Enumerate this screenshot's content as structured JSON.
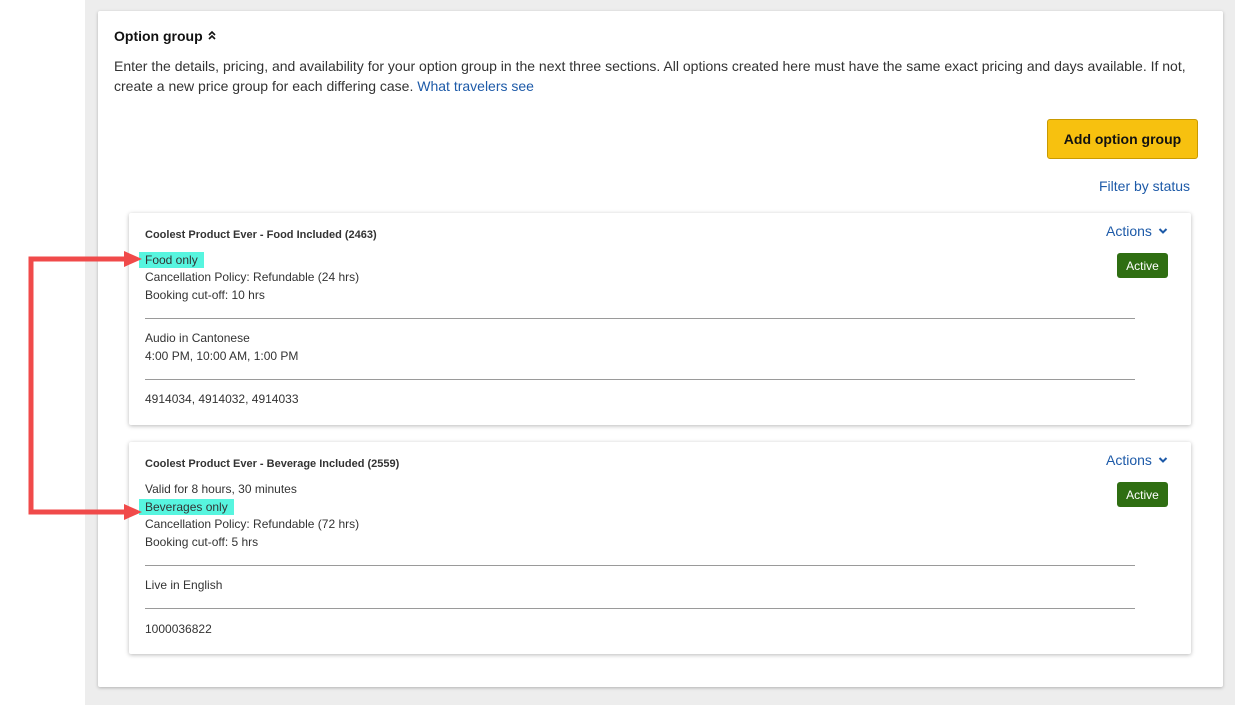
{
  "section": {
    "title": "Option group",
    "description": "Enter the details, pricing, and availability for your option group in the next three sections. All options created here must have the same exact pricing and days available. If not, create a new price group for each differing case.",
    "travelers_link": "What travelers see",
    "add_button": "Add option group",
    "filter_link": "Filter by status"
  },
  "cards": [
    {
      "title": "Coolest Product Ever - Food Included (2463)",
      "actions": "Actions",
      "status": "Active",
      "highlight": "Food only",
      "lines": [
        "Cancellation Policy: Refundable (24 hrs)",
        "Booking cut-off: 10 hrs"
      ],
      "details": [
        "Audio in Cantonese",
        "4:00 PM, 10:00 AM, 1:00 PM"
      ],
      "ids": "4914034, 4914032, 4914033"
    },
    {
      "title": "Coolest Product Ever - Beverage Included (2559)",
      "actions": "Actions",
      "status": "Active",
      "pre_line": "Valid for 8 hours, 30 minutes",
      "highlight": "Beverages only",
      "lines": [
        "Cancellation Policy: Refundable (72 hrs)",
        "Booking cut-off: 5 hrs"
      ],
      "details": [
        "Live in English"
      ],
      "ids": "1000036822"
    }
  ],
  "colors": {
    "accent_button": "#f7c10f",
    "link": "#1d5aa8",
    "status_active": "#2f6e12",
    "highlight": "#57f5df",
    "annotation_arrow": "#f04a4a"
  },
  "icons": {
    "section_toggle": "chevron-double-up-icon",
    "actions_dropdown": "chevron-down-icon"
  }
}
